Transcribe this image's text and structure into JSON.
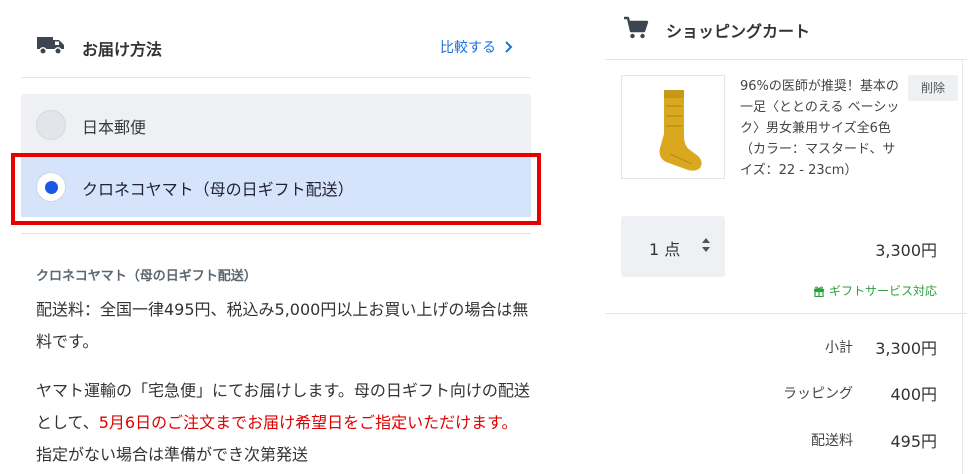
{
  "shipping": {
    "title": "お届け方法",
    "compare_label": "比較する",
    "options": [
      {
        "label": "日本郵便",
        "selected": false
      },
      {
        "label": "クロネコヤマト（母の日ギフト配送）",
        "selected": true
      }
    ],
    "detail": {
      "title": "クロネコヤマト（母の日ギフト配送）",
      "fee_line": "配送料：全国一律495円、税込み5,000円以上お買い上げの場合は無料です。",
      "note_pre": "ヤマト運輸の「宅急便」にてお届けします。母の日ギフト向けの配送として、",
      "note_red": "5月6日のご注文までお届け希望日をご指定いただけます。",
      "note_post": "指定がない場合は準備ができ次第発送"
    }
  },
  "cart": {
    "title": "ショッピングカート",
    "item": {
      "name": "96%の医師が推奨！基本の一足〈ととのえる ベーシック〉男女兼用サイズ全6色（カラー：マスタード、サイズ：22 - 23cm）",
      "delete_label": "削除",
      "quantity": "1 点",
      "price": "3,300円",
      "gift_label": "ギフトサービス対応"
    },
    "summary": {
      "subtotal_label": "小計",
      "subtotal_value": "3,300円",
      "wrapping_label": "ラッピング",
      "wrapping_value": "400円",
      "shipping_label": "配送料",
      "shipping_value": "495円"
    }
  },
  "colors": {
    "accent_blue": "#1e6fd9",
    "selected_bg": "#d6e4fb",
    "radio_dot": "#1a56e8",
    "highlight_red": "#e60000",
    "notice_red": "#e00000",
    "gift_green": "#2e9e3f"
  },
  "icons": {
    "shipping": "truck-icon",
    "compare": "chevron-right-icon",
    "cart": "cart-icon",
    "quantity": "sort-icon",
    "gift": "gift-icon"
  }
}
